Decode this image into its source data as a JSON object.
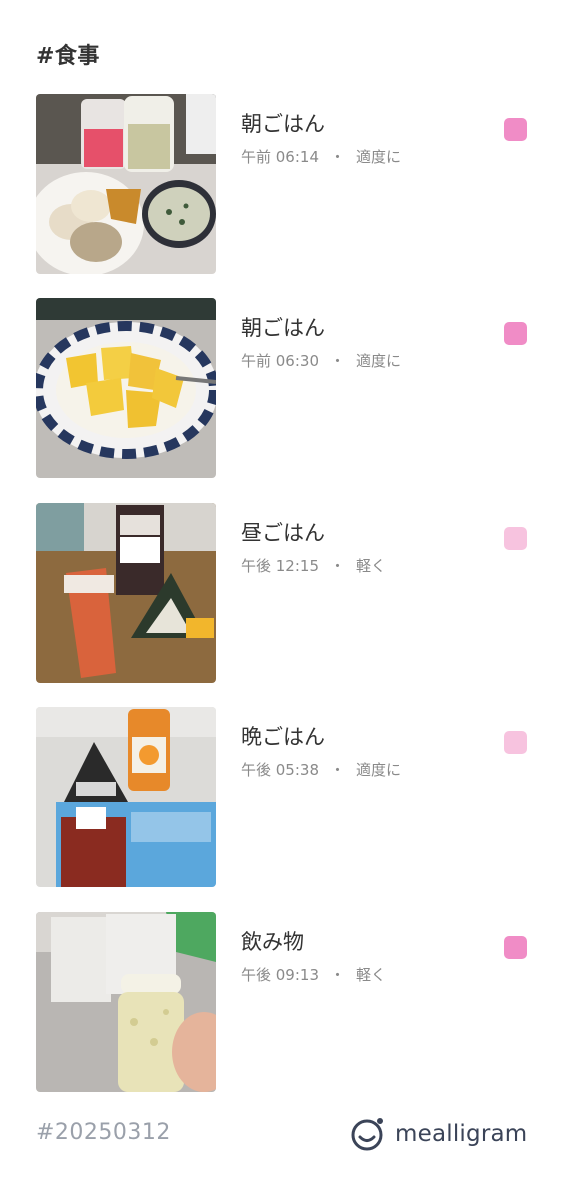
{
  "header": {
    "title": "#食事"
  },
  "meals": [
    {
      "title": "朝ごはん",
      "time": "午前 06:14",
      "separator": "・",
      "amount": "適度に",
      "dot_color": "#f08cc6"
    },
    {
      "title": "朝ごはん",
      "time": "午前 06:30",
      "separator": "・",
      "amount": "適度に",
      "dot_color": "#f08cc6"
    },
    {
      "title": "昼ごはん",
      "time": "午後 12:15",
      "separator": "・",
      "amount": "軽く",
      "dot_color": "#f7c3df"
    },
    {
      "title": "晩ごはん",
      "time": "午後 05:38",
      "separator": "・",
      "amount": "適度に",
      "dot_color": "#f7c3df"
    },
    {
      "title": "飲み物",
      "time": "午後 09:13",
      "separator": "・",
      "amount": "軽く",
      "dot_color": "#f08cc6"
    }
  ],
  "footer": {
    "date_tag": "#20250312",
    "brand": "mealligram",
    "logo_icon": "mealligram-smile-logo-icon"
  }
}
